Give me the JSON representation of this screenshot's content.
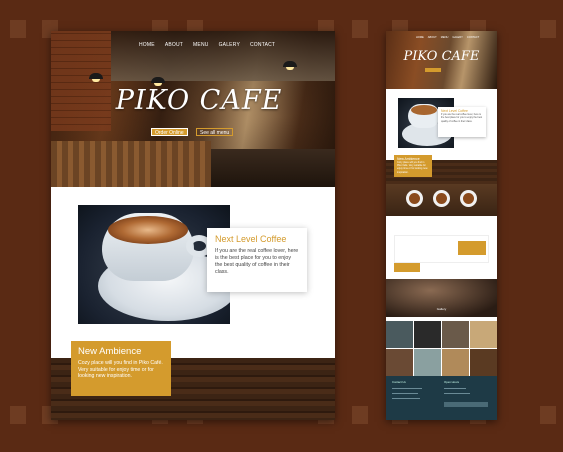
{
  "desktop": {
    "nav": [
      "HOME",
      "ABOUT",
      "MENU",
      "GALERY",
      "CONTACT"
    ],
    "title": "PIKO CAFE",
    "order_btn": "Order Online",
    "menu_btn": "See all menu",
    "section1": {
      "heading": "Next Level Coffee",
      "text": "If you are the real coffee lover, here is the best place for you to enjoy the best quality of coffee in their class."
    },
    "section2": {
      "heading": "New Ambience",
      "text": "Cozy place will you find in Piko Café. Very suitable for enjoy time or for looking new inspiration."
    }
  },
  "mobile": {
    "title": "PIKO CAFE",
    "gallery_label": "Gallery",
    "footer_contact": "Contact Us",
    "footer_hours": "Open Hours"
  },
  "colors": {
    "accent": "#d49b2d",
    "background": "#5a2a14",
    "footer": "#1e3a46"
  }
}
